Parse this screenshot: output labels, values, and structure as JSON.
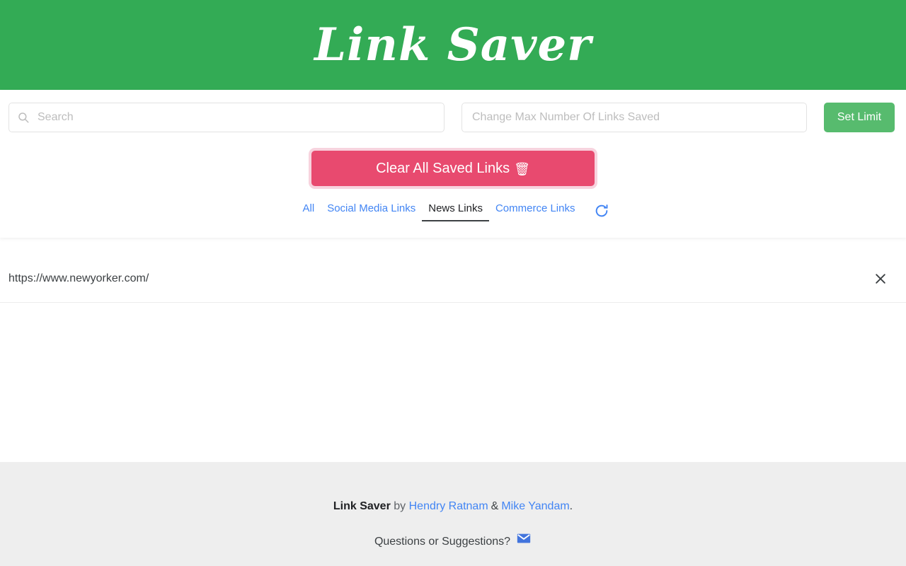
{
  "header": {
    "title": "Link Saver",
    "background_color": "#33ab55"
  },
  "toolbar": {
    "search": {
      "value": "",
      "placeholder": "Search",
      "icon": "search-icon"
    },
    "limit": {
      "value": "",
      "placeholder": "Change Max Number Of Links Saved"
    },
    "set_limit_label": "Set Limit",
    "set_limit_color": "#57bb6e",
    "clear_all_label": "Clear All Saved Links",
    "clear_all_icon": "🗑",
    "clear_all_color": "#e84a6f"
  },
  "tabs": {
    "items": [
      {
        "label": "All",
        "active": false
      },
      {
        "label": "Social Media Links",
        "active": false
      },
      {
        "label": "News Links",
        "active": true
      },
      {
        "label": "Commerce Links",
        "active": false
      }
    ],
    "refresh_icon": "refresh-icon",
    "link_color": "#4285f4",
    "active_color": "#202124"
  },
  "links": [
    {
      "url": "https://www.newyorker.com/",
      "close_icon": "close-icon"
    }
  ],
  "footer": {
    "brand": "Link Saver",
    "by": "by",
    "author_1": "Hendry Ratnam",
    "separator": "&",
    "author_2": "Mike Yandam",
    "period": ".",
    "question_text": "Questions or Suggestions?",
    "mail_icon": "mail-icon",
    "background_color": "#eeeeee",
    "link_color": "#4285f4"
  }
}
